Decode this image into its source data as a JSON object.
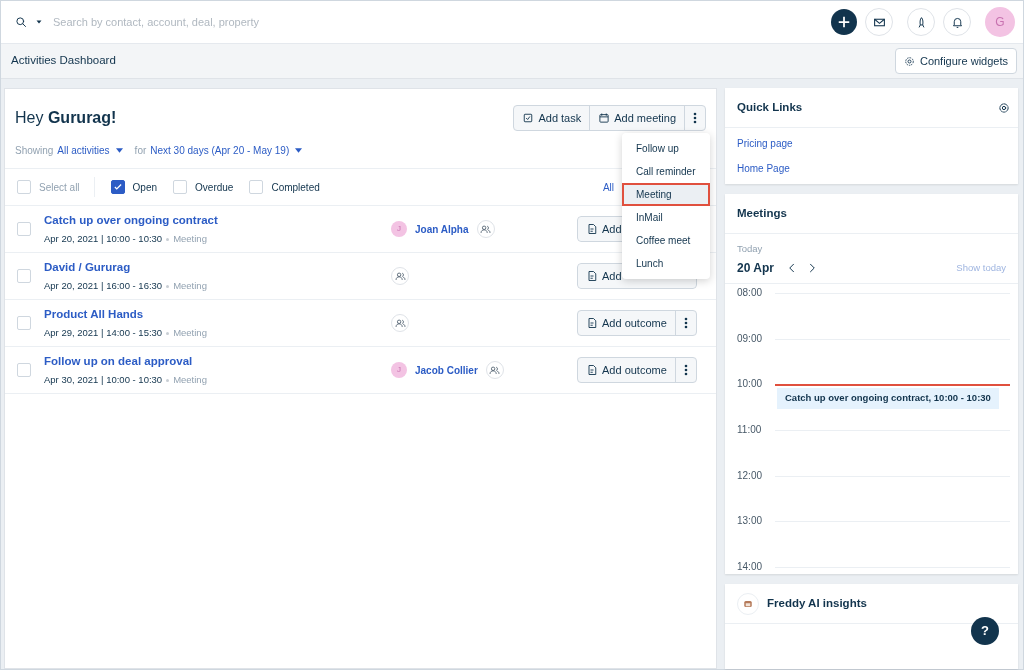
{
  "topbar": {
    "search_placeholder": "Search by contact, account, deal, property",
    "avatar_initial": "G"
  },
  "subheader": {
    "title": "Activities Dashboard",
    "configure_button": "Configure widgets"
  },
  "activities": {
    "greeting": "Hey **Gururag!**",
    "buttons": [
      "Add task",
      "Add meeting"
    ],
    "filter": {
      "showing_label": "Showing",
      "activity_filter": "All activities",
      "for_label": "for",
      "range_filter": "Next 30 days (Apr 20 - May 19)"
    },
    "status_filters": [
      {
        "label": "Select all",
        "checked": false,
        "kind": "select"
      },
      {
        "label": "Open",
        "checked": true,
        "kind": "status"
      },
      {
        "label": "Overdue",
        "checked": false,
        "kind": "status"
      },
      {
        "label": "Completed",
        "checked": false,
        "kind": "status"
      }
    ],
    "right_link": "All",
    "rows": [
      {
        "title": "Catch up over ongoing contract",
        "when": "Apr 20, 2021 | 10:00 - 10:30",
        "type": "Meeting",
        "contact_initial": "J",
        "contact": "Joan Alpha",
        "outcome": "Add",
        "more_button": false,
        "checked": false
      },
      {
        "title": "David / Gururag",
        "when": "Apr 20, 2021 | 16:00 - 16:30",
        "type": "Meeting",
        "outcome": "Add",
        "more_button": false,
        "checked": false
      },
      {
        "title": "Product All Hands",
        "when": "Apr 29, 2021 | 14:00 - 15:30",
        "type": "Meeting",
        "outcome": "Add outcome",
        "more_button": true,
        "checked": false
      },
      {
        "title": "Follow up on deal approval",
        "when": "Apr 30, 2021 | 10:00 - 10:30",
        "type": "Meeting",
        "contact_initial": "J",
        "contact": "Jacob Collier",
        "outcome": "Add outcome",
        "more_button": true,
        "checked": false
      }
    ],
    "menu": [
      {
        "label": "Follow up",
        "selected": false
      },
      {
        "label": "Call reminder",
        "selected": false
      },
      {
        "label": "Meeting",
        "selected": true
      },
      {
        "label": "InMail",
        "selected": false
      },
      {
        "label": "Coffee meet",
        "selected": false
      },
      {
        "label": "Lunch",
        "selected": false
      }
    ]
  },
  "quick_links": {
    "title": "Quick Links",
    "links": [
      "Pricing page",
      "Home Page"
    ]
  },
  "meetings": {
    "title": "Meetings",
    "today_label": "Today",
    "date": "20 Apr",
    "show_today": "Show today",
    "hours": [
      {
        "label": "08:00",
        "now": false
      },
      {
        "label": "09:00",
        "now": false
      },
      {
        "label": "10:00",
        "now": true,
        "events": [
          "Catch up over ongoing contract, 10:00 - 10:30"
        ]
      },
      {
        "label": "11:00",
        "now": false
      },
      {
        "label": "12:00",
        "now": false
      },
      {
        "label": "13:00",
        "now": false
      },
      {
        "label": "14:00",
        "now": false
      }
    ]
  },
  "insights": {
    "title": "Freddy AI insights"
  },
  "help_button": "?"
}
